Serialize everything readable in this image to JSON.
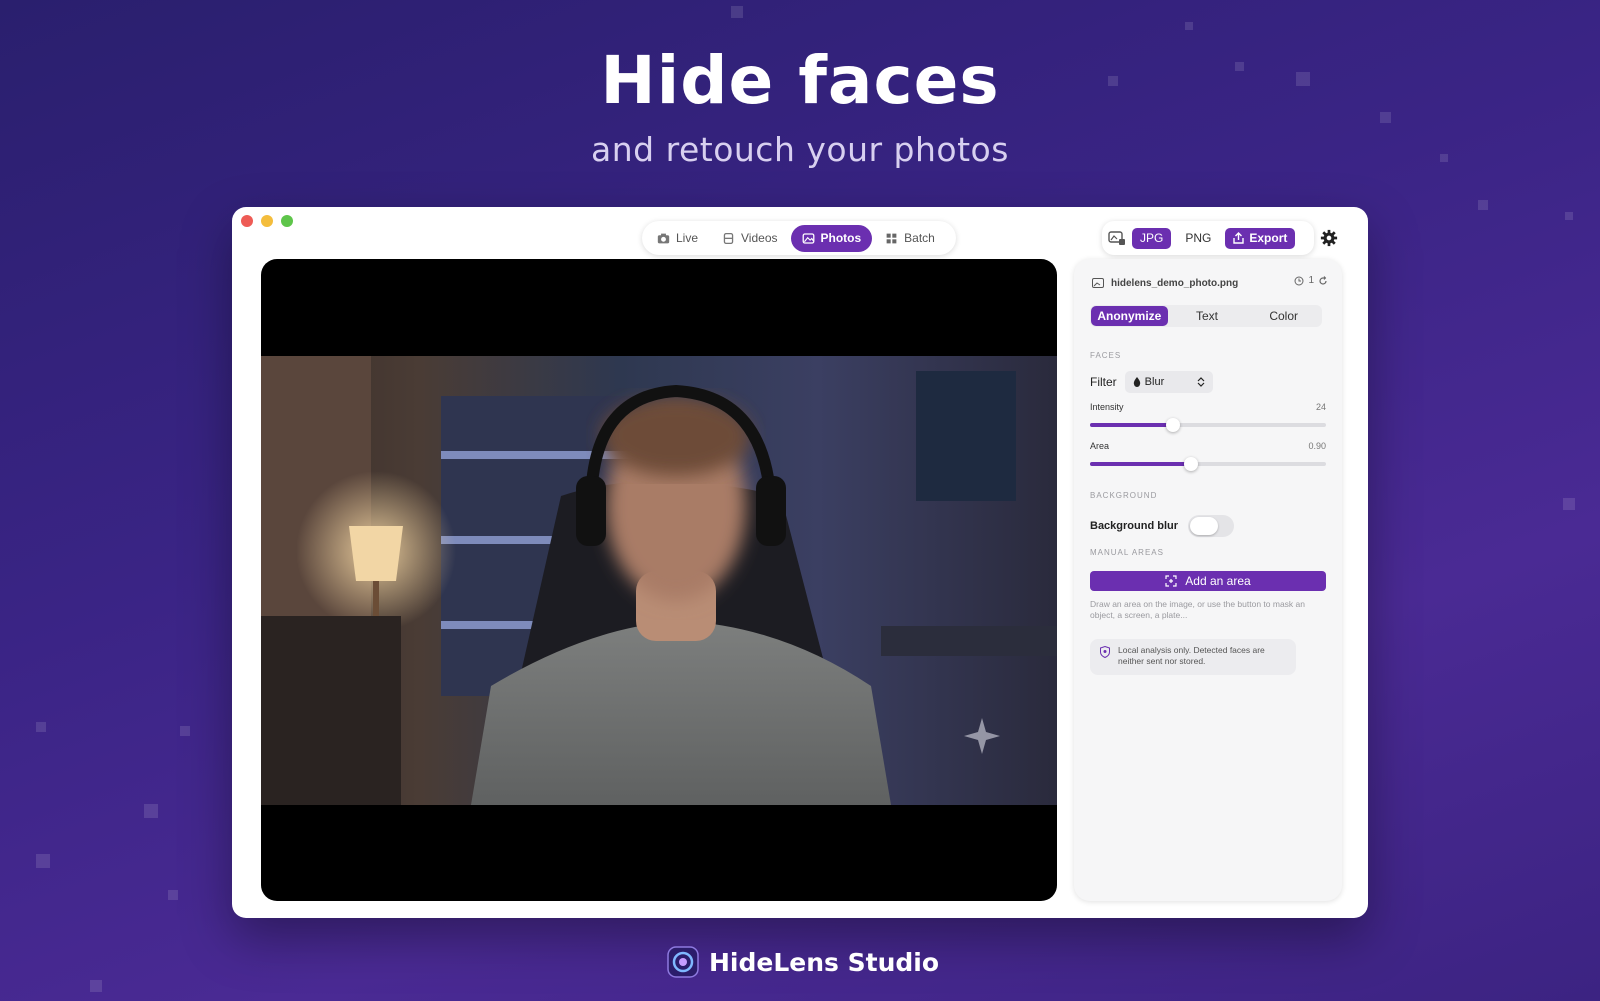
{
  "hero": {
    "title": "Hide faces",
    "subtitle": "and retouch your photos"
  },
  "modes": [
    {
      "label": "Live",
      "icon": "camera-icon"
    },
    {
      "label": "Videos",
      "icon": "video-icon"
    },
    {
      "label": "Photos",
      "icon": "photo-icon",
      "active": true
    },
    {
      "label": "Batch",
      "icon": "grid-icon"
    }
  ],
  "export": {
    "jpg": "JPG",
    "png": "PNG",
    "export_label": "Export",
    "selected_format": "JPG"
  },
  "file": {
    "name": "hidelens_demo_photo.png",
    "count": "1"
  },
  "tabs": [
    {
      "label": "Anonymize",
      "active": true
    },
    {
      "label": "Text"
    },
    {
      "label": "Color"
    }
  ],
  "faces": {
    "section": "FACES",
    "filter_label": "Filter",
    "filter_value": "Blur",
    "intensity_label": "Intensity",
    "intensity_value": "24",
    "intensity_fraction": 0.35,
    "area_label": "Area",
    "area_value": "0.90",
    "area_fraction": 0.43
  },
  "background": {
    "section": "BACKGROUND",
    "blur_label": "Background blur",
    "blur_on": false
  },
  "manual": {
    "section": "MANUAL AREAS",
    "add_label": "Add an area",
    "hint": "Draw an area on the image, or use the button to mask an object, a screen, a plate...",
    "note": "Local analysis only. Detected faces are neither sent nor stored."
  },
  "brand": {
    "name": "HideLens Studio"
  },
  "colors": {
    "accent": "#6b2fb0",
    "background": "#3a2485"
  }
}
